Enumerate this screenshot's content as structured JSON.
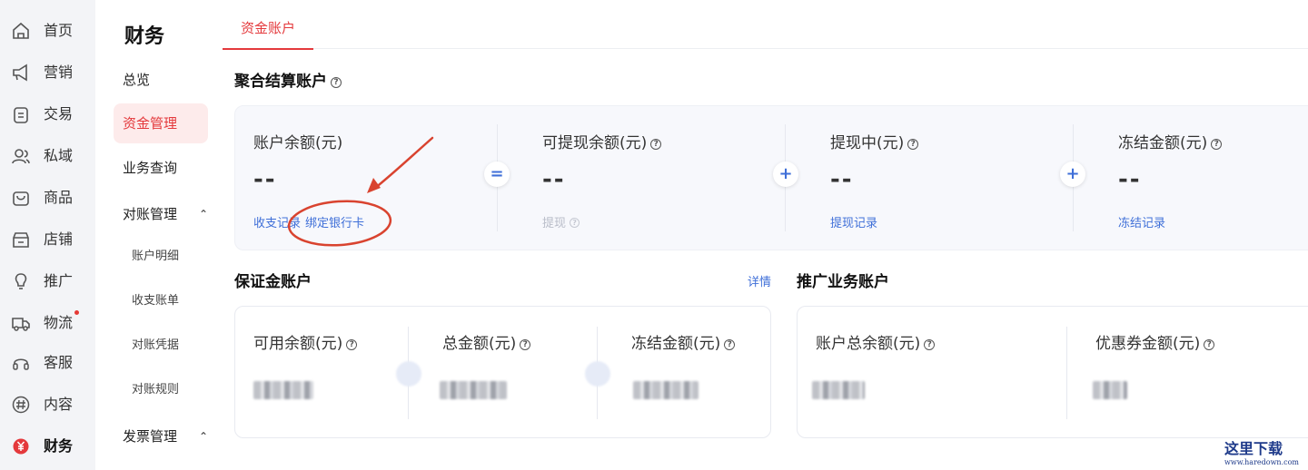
{
  "rail": {
    "items": [
      {
        "label": "首页",
        "icon": "home-icon"
      },
      {
        "label": "营销",
        "icon": "megaphone-icon"
      },
      {
        "label": "交易",
        "icon": "clipboard-icon"
      },
      {
        "label": "私域",
        "icon": "users-icon"
      },
      {
        "label": "商品",
        "icon": "bag-icon"
      },
      {
        "label": "店铺",
        "icon": "store-icon"
      },
      {
        "label": "推广",
        "icon": "bulb-icon"
      },
      {
        "label": "物流",
        "icon": "truck-icon"
      },
      {
        "label": "客服",
        "icon": "headset-icon"
      },
      {
        "label": "内容",
        "icon": "hash-icon"
      },
      {
        "label": "财务",
        "icon": "yen-icon"
      }
    ],
    "active": "财务",
    "accent": "#e4393c"
  },
  "subnav": {
    "title": "财务",
    "items": {
      "overview": "总览",
      "funds": "资金管理",
      "business_query": "业务查询",
      "reconcile": "对账管理",
      "account_detail": "账户明细",
      "income_bill": "收支账单",
      "reconcile_voucher": "对账凭据",
      "reconcile_rule": "对账规则",
      "invoice": "发票管理"
    }
  },
  "tab": {
    "label": "资金账户"
  },
  "aggregate": {
    "title": "聚合结算账户",
    "balance": {
      "title": "账户余额(元)",
      "value": "--",
      "link1": "收支记录",
      "link2": "绑定银行卡"
    },
    "withdrawable": {
      "title": "可提现余额(元)",
      "value": "--",
      "link": "提现"
    },
    "withdrawing": {
      "title": "提现中(元)",
      "value": "--",
      "link": "提现记录"
    },
    "frozen": {
      "title": "冻结金额(元)",
      "value": "--",
      "link": "冻结记录"
    },
    "op_equals": "=",
    "op_plus": "+"
  },
  "deposit": {
    "title": "保证金账户",
    "detail": "详情",
    "available": "可用余额(元)",
    "total": "总金额(元)",
    "frozen": "冻结金额(元)"
  },
  "promo": {
    "title": "推广业务账户",
    "total_balance": "账户总余额(元)",
    "coupon": "优惠券金额(元)"
  },
  "watermark": {
    "text": "这里下载",
    "url_text": "www.haredown.com"
  },
  "colors": {
    "link": "#3f6fd8",
    "annotation": "#d9432f"
  }
}
